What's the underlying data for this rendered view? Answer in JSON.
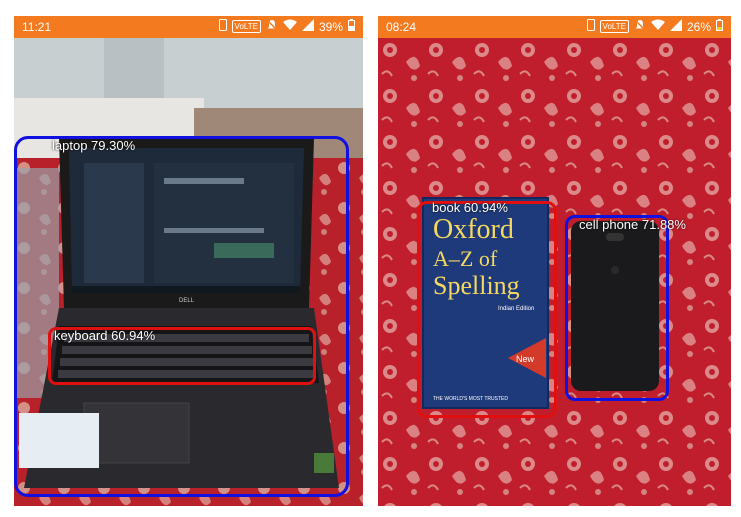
{
  "panels": [
    {
      "status_time": "11:21",
      "status_volte": "VoLTE",
      "status_battery": "39%",
      "detections": [
        {
          "label": "laptop 79.30%",
          "color": "#1010e0"
        },
        {
          "label": "keyboard 60.94%",
          "color": "#e01010"
        }
      ]
    },
    {
      "status_time": "08:24",
      "status_volte": "VoLTE",
      "status_battery": "26%",
      "detections": [
        {
          "label": "book 60.94%",
          "color": "#e01010"
        },
        {
          "label": "cell phone 71.88%",
          "color": "#1010e0"
        }
      ]
    }
  ],
  "book_cover": {
    "title_line1": "Oxford",
    "title_line2": "A–Z of",
    "title_line3": "Spelling",
    "edition": "Indian Edition",
    "badge": "New",
    "footer": "THE WORLD'S MOST TRUSTED"
  },
  "laptop_brand": "DELL",
  "colors": {
    "status_bar": "#f47a20",
    "box_blue": "#1010e0",
    "box_red": "#e01010"
  }
}
